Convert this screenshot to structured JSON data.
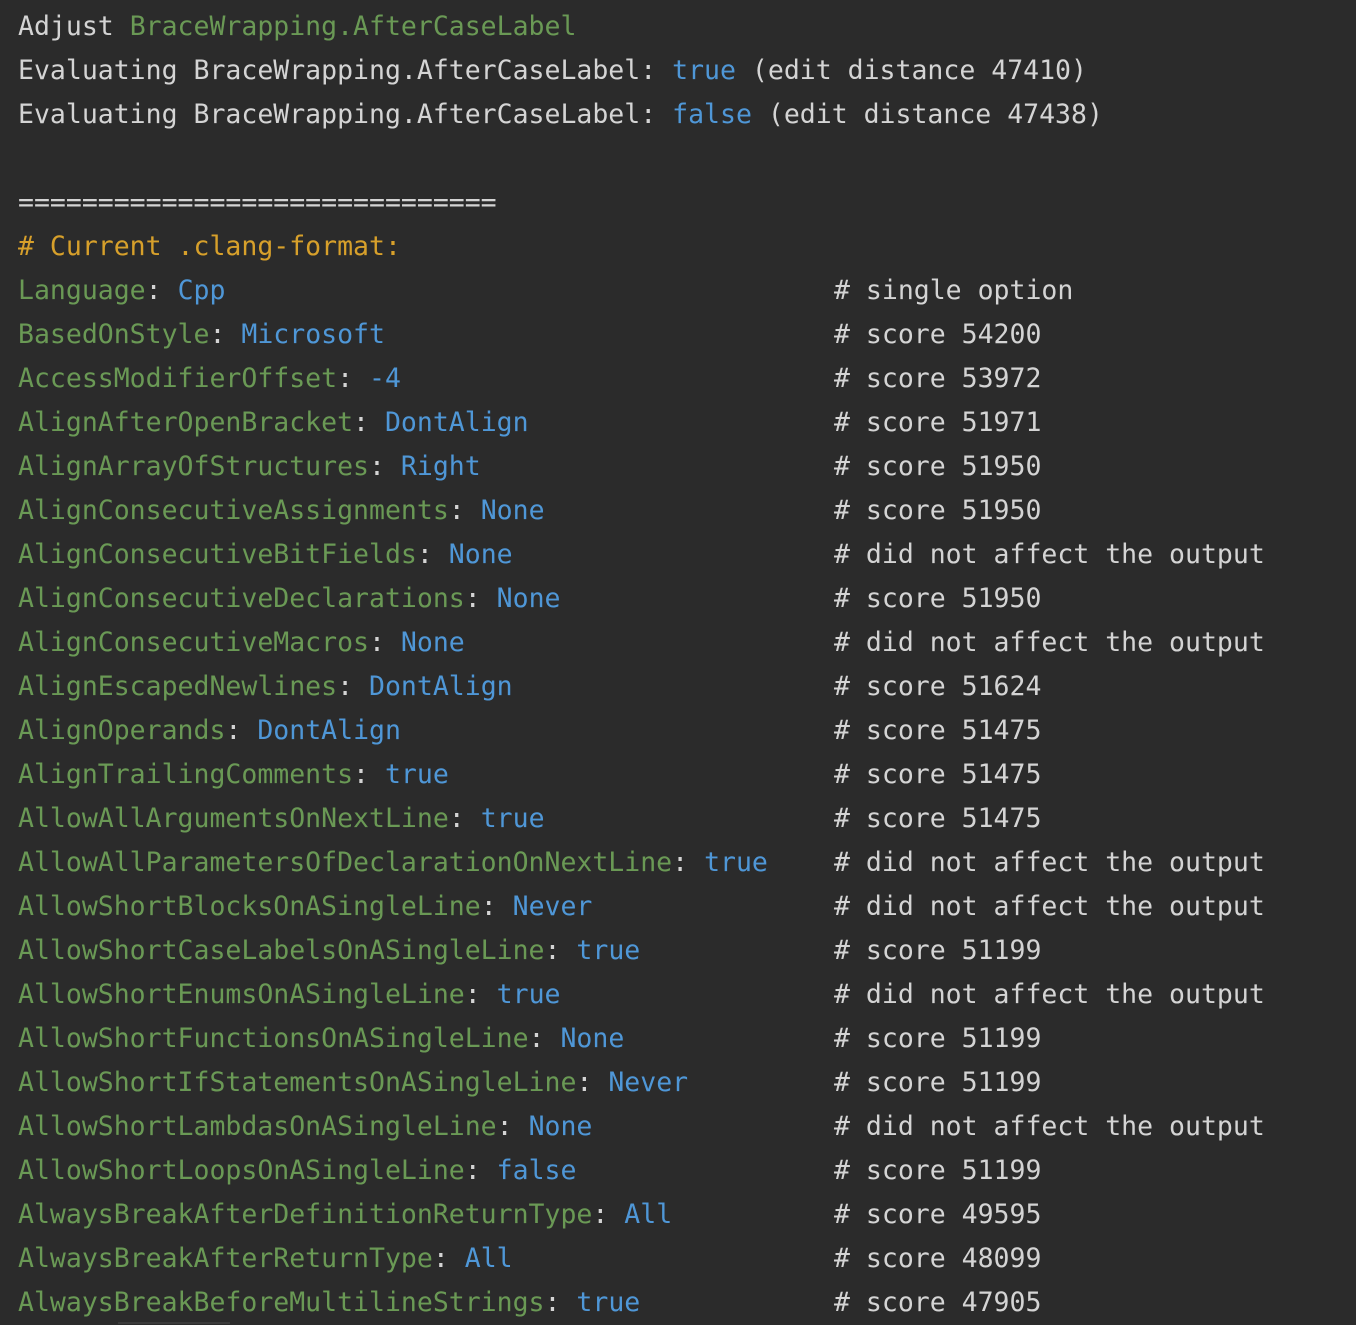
{
  "header": [
    {
      "prefix": "Adjust ",
      "highlight": "BraceWrapping.AfterCaseLabel",
      "highlight_color": "green",
      "suffix": ""
    },
    {
      "prefix": "Evaluating BraceWrapping.AfterCaseLabel: ",
      "highlight": "true",
      "highlight_color": "blue",
      "suffix": " (edit distance 47410)"
    },
    {
      "prefix": "Evaluating BraceWrapping.AfterCaseLabel: ",
      "highlight": "false",
      "highlight_color": "blue",
      "suffix": " (edit distance 47438)"
    }
  ],
  "separator": "==============================",
  "section_title": "# Current .clang-format:",
  "options": [
    {
      "key": "Language",
      "value": "Cpp",
      "comment": "# single option"
    },
    {
      "key": "BasedOnStyle",
      "value": "Microsoft",
      "comment": "# score 54200"
    },
    {
      "key": "AccessModifierOffset",
      "value": "-4",
      "comment": "# score 53972"
    },
    {
      "key": "AlignAfterOpenBracket",
      "value": "DontAlign",
      "comment": "# score 51971"
    },
    {
      "key": "AlignArrayOfStructures",
      "value": "Right",
      "comment": "# score 51950"
    },
    {
      "key": "AlignConsecutiveAssignments",
      "value": "None",
      "comment": "# score 51950"
    },
    {
      "key": "AlignConsecutiveBitFields",
      "value": "None",
      "comment": "# did not affect the output"
    },
    {
      "key": "AlignConsecutiveDeclarations",
      "value": "None",
      "comment": "# score 51950"
    },
    {
      "key": "AlignConsecutiveMacros",
      "value": "None",
      "comment": "# did not affect the output"
    },
    {
      "key": "AlignEscapedNewlines",
      "value": "DontAlign",
      "comment": "# score 51624"
    },
    {
      "key": "AlignOperands",
      "value": "DontAlign",
      "comment": "# score 51475"
    },
    {
      "key": "AlignTrailingComments",
      "value": "true",
      "comment": "# score 51475"
    },
    {
      "key": "AllowAllArgumentsOnNextLine",
      "value": "true",
      "comment": "# score 51475"
    },
    {
      "key": "AllowAllParametersOfDeclarationOnNextLine",
      "value": "true",
      "comment": "# did not affect the output"
    },
    {
      "key": "AllowShortBlocksOnASingleLine",
      "value": "Never",
      "comment": "# did not affect the output"
    },
    {
      "key": "AllowShortCaseLabelsOnASingleLine",
      "value": "true",
      "comment": "# score 51199"
    },
    {
      "key": "AllowShortEnumsOnASingleLine",
      "value": "true",
      "comment": "# did not affect the output"
    },
    {
      "key": "AllowShortFunctionsOnASingleLine",
      "value": "None",
      "comment": "# score 51199"
    },
    {
      "key": "AllowShortIfStatementsOnASingleLine",
      "value": "Never",
      "comment": "# score 51199"
    },
    {
      "key": "AllowShortLambdasOnASingleLine",
      "value": "None",
      "comment": "# did not affect the output"
    },
    {
      "key": "AllowShortLoopsOnASingleLine",
      "value": "false",
      "comment": "# score 51199"
    },
    {
      "key": "AlwaysBreakAfterDefinitionReturnType",
      "value": "All",
      "comment": "# score 49595"
    },
    {
      "key": "AlwaysBreakAfterReturnType",
      "value": "All",
      "comment": "# score 48099"
    },
    {
      "key": "AlwaysBreakBeforeMultilineStrings",
      "value": "true",
      "comment": "# score 47905"
    }
  ],
  "colors": {
    "background": "#2b2b2b",
    "text": "#d4d4d4",
    "key": "#6a9955",
    "value": "#4f97d7",
    "section_title": "#d7a02b"
  }
}
